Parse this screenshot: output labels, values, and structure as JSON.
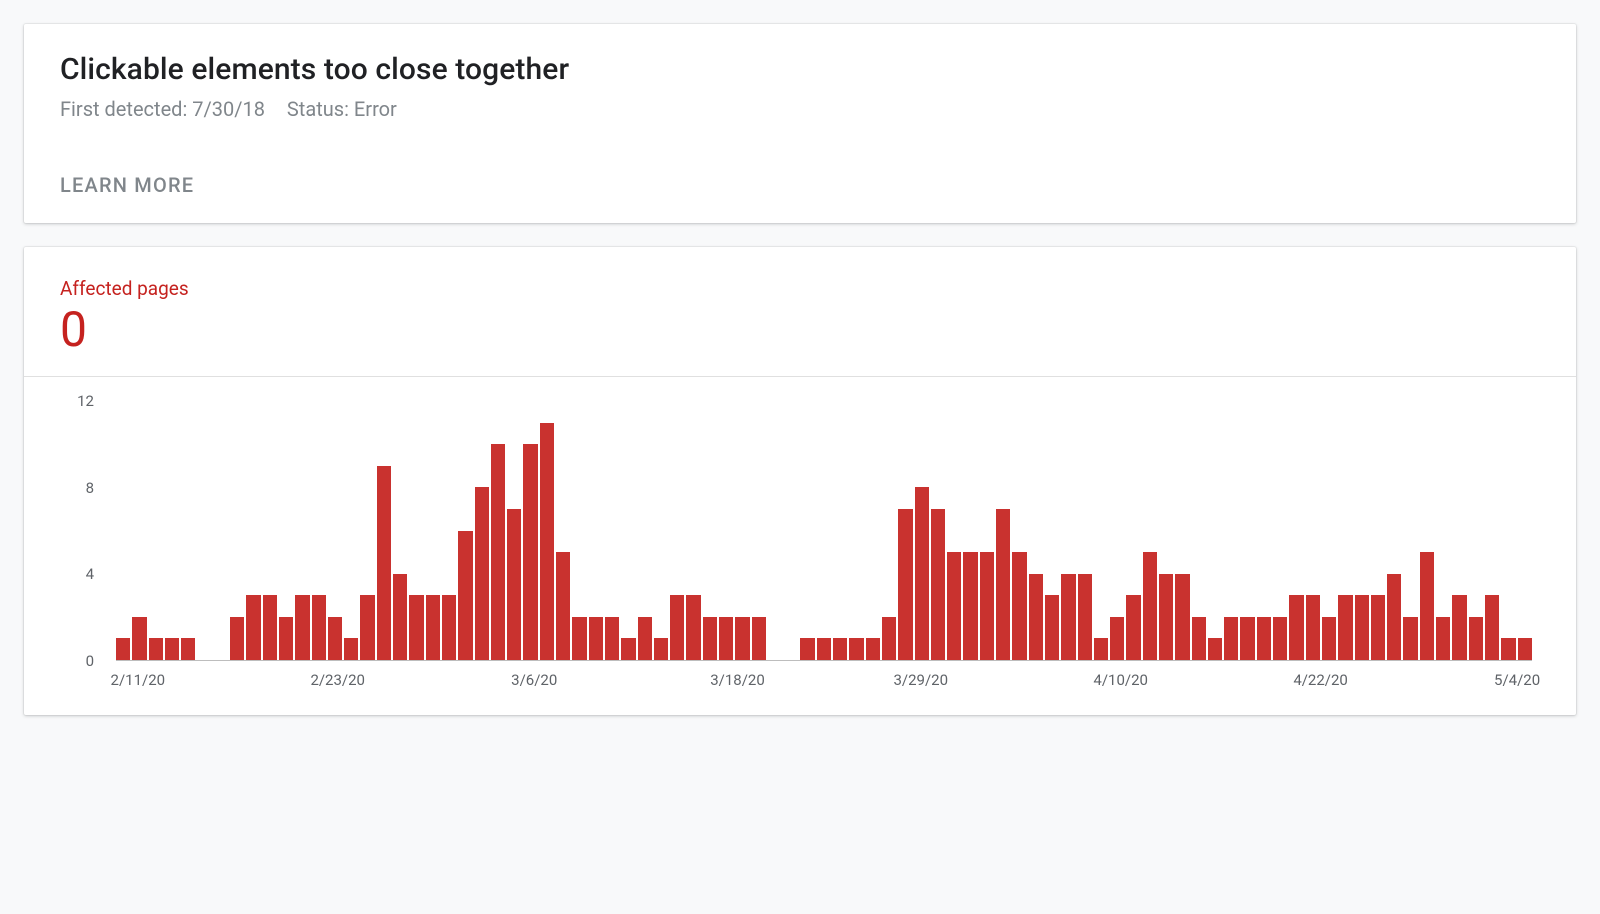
{
  "issue": {
    "title": "Clickable elements too close together",
    "first_detected_label": "First detected:",
    "first_detected_value": "7/30/18",
    "status_label": "Status:",
    "status_value": "Error",
    "learn_more": "LEARN MORE"
  },
  "affected": {
    "label": "Affected pages",
    "value": "0"
  },
  "chart_data": {
    "type": "bar",
    "title": "Affected pages",
    "ylabel": "",
    "xlabel": "",
    "ylim": [
      0,
      12
    ],
    "y_ticks": [
      0,
      4,
      8,
      12
    ],
    "x_tick_labels": [
      "2/11/20",
      "2/23/20",
      "3/6/20",
      "3/18/20",
      "3/29/20",
      "4/10/20",
      "4/22/20",
      "5/4/20"
    ],
    "categories": [
      "2/11/20",
      "2/12/20",
      "2/13/20",
      "2/14/20",
      "2/15/20",
      "2/16/20",
      "2/17/20",
      "2/18/20",
      "2/19/20",
      "2/20/20",
      "2/21/20",
      "2/22/20",
      "2/23/20",
      "2/24/20",
      "2/25/20",
      "2/26/20",
      "2/27/20",
      "2/28/20",
      "2/29/20",
      "3/1/20",
      "3/2/20",
      "3/3/20",
      "3/4/20",
      "3/5/20",
      "3/6/20",
      "3/7/20",
      "3/8/20",
      "3/9/20",
      "3/10/20",
      "3/11/20",
      "3/12/20",
      "3/13/20",
      "3/14/20",
      "3/15/20",
      "3/16/20",
      "3/17/20",
      "3/18/20",
      "3/19/20",
      "3/20/20",
      "3/21/20",
      "3/22/20",
      "3/23/20",
      "3/24/20",
      "3/25/20",
      "3/26/20",
      "3/27/20",
      "3/28/20",
      "3/29/20",
      "3/30/20",
      "3/31/20",
      "4/1/20",
      "4/2/20",
      "4/3/20",
      "4/4/20",
      "4/5/20",
      "4/6/20",
      "4/7/20",
      "4/8/20",
      "4/9/20",
      "4/10/20",
      "4/11/20",
      "4/12/20",
      "4/13/20",
      "4/14/20",
      "4/15/20",
      "4/16/20",
      "4/17/20",
      "4/18/20",
      "4/19/20",
      "4/20/20",
      "4/21/20",
      "4/22/20",
      "4/23/20",
      "4/24/20",
      "4/25/20",
      "4/26/20",
      "4/27/20",
      "4/28/20",
      "4/29/20",
      "4/30/20",
      "5/1/20",
      "5/2/20",
      "5/3/20",
      "5/4/20",
      "5/5/20",
      "5/6/20"
    ],
    "values": [
      1,
      2,
      1,
      1,
      1,
      0,
      0,
      2,
      3,
      3,
      2,
      3,
      3,
      2,
      1,
      3,
      9,
      4,
      3,
      3,
      3,
      6,
      8,
      10,
      7,
      10,
      11,
      5,
      2,
      2,
      2,
      1,
      2,
      1,
      3,
      3,
      2,
      2,
      2,
      2,
      0,
      0,
      1,
      1,
      1,
      1,
      1,
      2,
      7,
      8,
      7,
      5,
      5,
      5,
      7,
      5,
      4,
      3,
      4,
      4,
      1,
      2,
      3,
      5,
      4,
      4,
      2,
      1,
      2,
      2,
      2,
      2,
      3,
      3,
      2,
      3,
      3,
      3,
      4,
      2,
      5,
      2,
      3,
      2,
      3,
      1,
      1
    ],
    "bar_color": "#c5221f"
  }
}
